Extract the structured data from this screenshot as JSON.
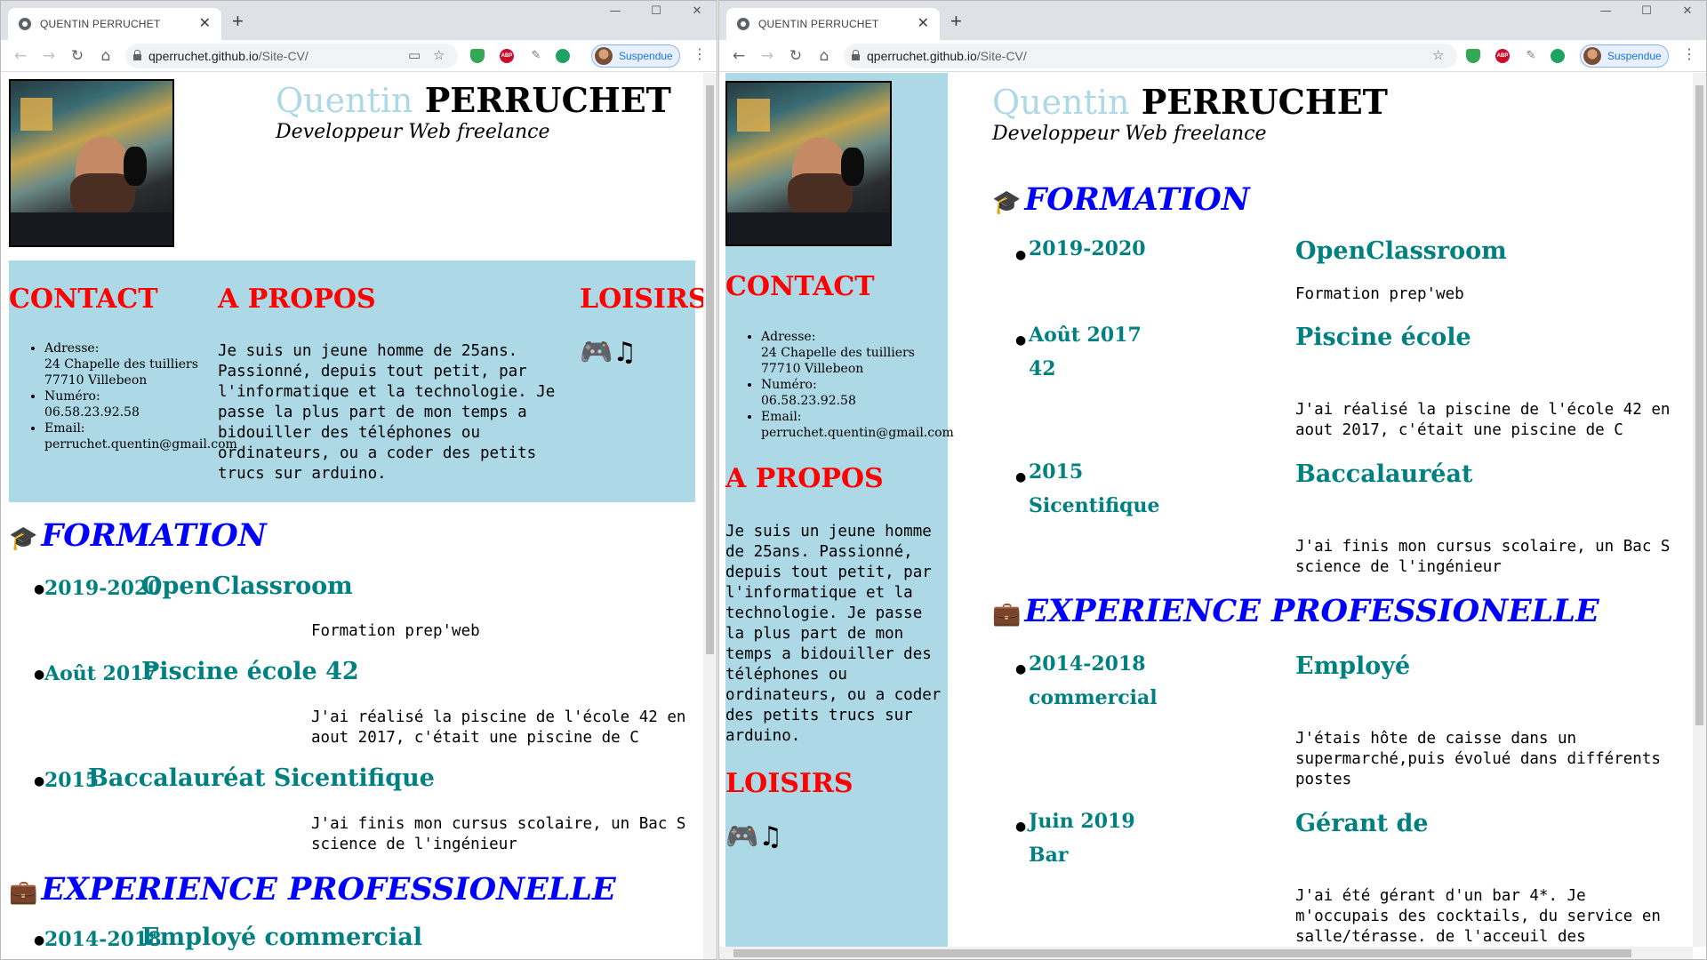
{
  "browser": {
    "tab_title": "QUENTIN PERRUCHET",
    "new_tab": "+",
    "url_host": "qperruchet.github.io",
    "url_path": "/Site-CV/",
    "profile_label": "Suspendue",
    "icons": {
      "back": "←",
      "forward": "→",
      "reload": "↻",
      "home": "⌂",
      "minimize": "—",
      "maximize": "☐",
      "close": "✕",
      "tab_close": "✕",
      "star": "☆",
      "cast": "▭",
      "pen": "✎",
      "menu": "⋮",
      "abp": "ABP"
    }
  },
  "cv": {
    "first_name": "Quentin",
    "last_name": "PERRUCHET",
    "subtitle": "Developpeur Web freelance",
    "contact": {
      "title": "CONTACT",
      "address_label": "Adresse:",
      "address_line1": "24 Chapelle des tuilliers",
      "address_line2": "77710 Villebeon",
      "phone_label": "Numéro:",
      "phone": "06.58.23.92.58",
      "email_label": "Email:",
      "email": "perruchet.quentin@gmail.com"
    },
    "about": {
      "title": "A PROPOS",
      "text": "Je suis un jeune homme de 25ans. Passionné, depuis tout petit, par l'informatique et la technologie. Je passe la plus part de mon temps a bidouiller des téléphones ou ordinateurs, ou a coder des petits trucs sur arduino."
    },
    "hobbies": {
      "title": "LOISIRS",
      "icons": "🎮♫"
    },
    "formation": {
      "title": "FORMATION",
      "icon": "🎓",
      "items": [
        {
          "date": "2019-2020",
          "title": "OpenClassroom",
          "desc": "Formation prep'web"
        },
        {
          "date": "Août 2017",
          "title": "Piscine école 42",
          "desc": "J'ai réalisé la piscine de l'école 42 en aout 2017, c'était une piscine de C"
        },
        {
          "date": "2015",
          "title": "Baccalauréat Sicentifique",
          "desc": "J'ai finis mon cursus scolaire, un Bac S science de l'ingénieur"
        }
      ]
    },
    "experience": {
      "title": "EXPERIENCE PROFESSIONELLE",
      "icon": "💼",
      "items": [
        {
          "date": "2014-2018",
          "title": "Employé commercial",
          "desc": "J'étais hôte de caisse dans un supermarché,puis évolué dans différents postes"
        },
        {
          "date": "Juin 2019",
          "title": "Gérant de Bar",
          "desc": "J'ai été gérant d'un bar 4*. Je m'occupais des cocktails, du service en salle/térasse. de l'acceuil des"
        }
      ]
    }
  },
  "right_split": {
    "formation_date_1": "2019-2020",
    "formation_title_1": "OpenClassroom",
    "formation_date_2a": "Août 2017",
    "formation_date_2b": "42",
    "formation_title_2": "Piscine école",
    "formation_date_3a": "2015",
    "formation_date_3b": "Sicentifique",
    "formation_title_3": "Baccalauréat",
    "exp_date_1a": "2014-2018",
    "exp_date_1b": "commercial",
    "exp_title_1": "Employé",
    "exp_date_2a": "Juin 2019",
    "exp_date_2b": "Bar",
    "exp_title_2": "Gérant de"
  },
  "colors": {
    "first_name": "#add8e6",
    "section_red": "#ff0000",
    "section_blue": "#0000ff",
    "entry_teal": "#008080",
    "panel_bg": "#add8e6"
  }
}
